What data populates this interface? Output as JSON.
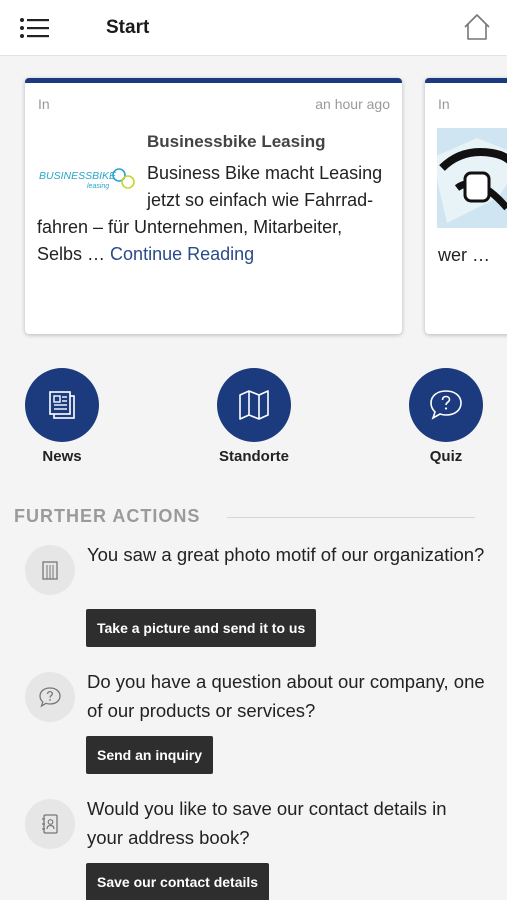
{
  "header": {
    "title": "Start",
    "menu_icon": "hamburger-menu-icon",
    "home_icon": "home-icon"
  },
  "cards": [
    {
      "meta_left": "In",
      "meta_right": "an hour ago",
      "headline": "Businessbike Leasing",
      "logo_text": "BUSINESSBIKE",
      "logo_sub": "leasing",
      "body": "Business Bike macht Leasing jetzt so einfach wie Fahrrad- fahren – für Unternehmen, Mitarbeiter, Selbs …",
      "more": "Continue Reading"
    },
    {
      "meta_left": "In",
      "body": "wer …"
    }
  ],
  "shortcuts": [
    {
      "label": "News",
      "icon": "newspaper-icon"
    },
    {
      "label": "Standorte",
      "icon": "map-icon"
    },
    {
      "label": "Quiz",
      "icon": "speech-bubble-question-icon"
    }
  ],
  "further_actions": {
    "heading": "FURTHER ACTIONS",
    "items": [
      {
        "icon": "building-icon",
        "text": "You saw a great photo motif of our organization?",
        "button": "Take a picture and send it to us"
      },
      {
        "icon": "question-bubble-icon",
        "text": "Do you have a question about our company, one of our products or services?",
        "button": "Send an inquiry"
      },
      {
        "icon": "address-book-icon",
        "text": "Would you like to save our contact details in your address book?",
        "button": "Save our contact details"
      }
    ]
  },
  "colors": {
    "accent": "#1c3a7e",
    "button_bg": "#2e2e2e",
    "link": "#2a4a8a"
  }
}
